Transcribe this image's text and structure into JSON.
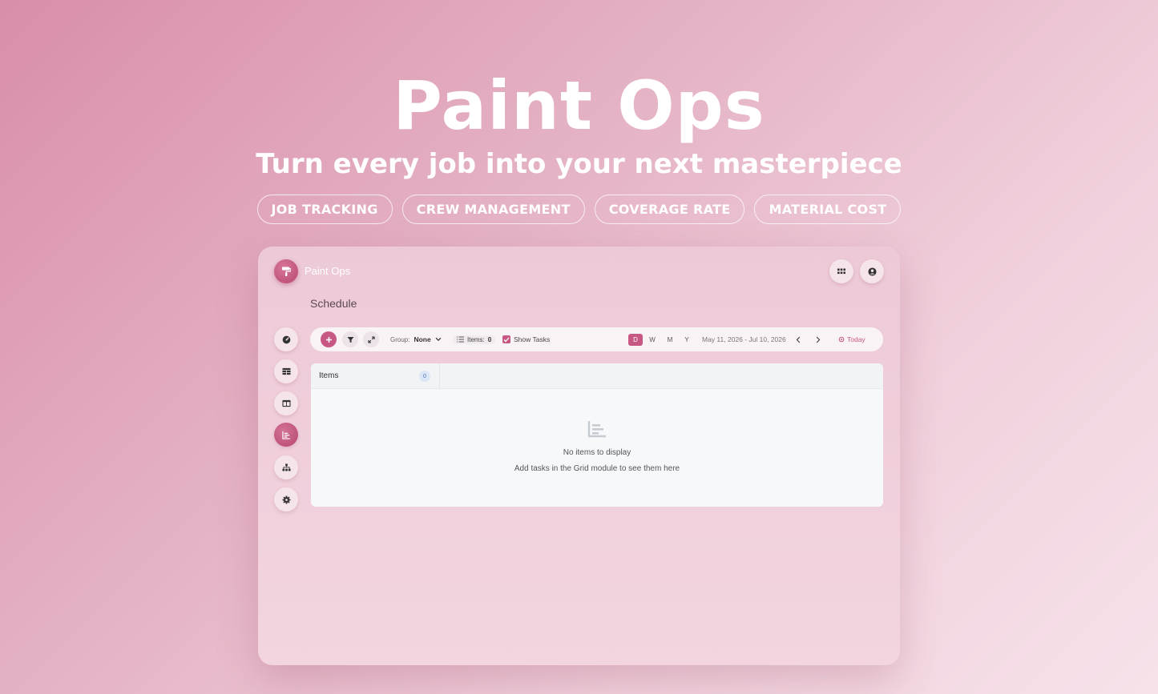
{
  "hero": {
    "title": "Paint Ops",
    "subtitle": "Turn every job into your next masterpiece",
    "pills": [
      "JOB TRACKING",
      "CREW MANAGEMENT",
      "COVERAGE RATE",
      "MATERIAL COST"
    ]
  },
  "app": {
    "brand": "Paint Ops",
    "page_title": "Schedule",
    "accent_color": "#c75884",
    "top_icons": [
      "apps-grid-icon",
      "account-icon"
    ],
    "sidebar_icons": [
      "dashboard-icon",
      "table-icon",
      "board-icon",
      "chart-icon",
      "hierarchy-icon",
      "settings-icon"
    ],
    "sidebar_active": "chart-icon",
    "toolbar": {
      "group_label": "Group:",
      "group_value": "None",
      "items_label": "Items:",
      "items_count": "0",
      "show_tasks_label": "Show Tasks",
      "show_tasks_checked": true,
      "scales": [
        "D",
        "W",
        "M",
        "Y"
      ],
      "active_scale": "D",
      "date_range": "May 11, 2026 - Jul 10, 2026",
      "today_label": "Today"
    },
    "panel": {
      "column_label": "Items",
      "column_count": "0",
      "empty_title": "No items to display",
      "empty_subtitle": "Add tasks in the Grid module to see them here"
    }
  }
}
